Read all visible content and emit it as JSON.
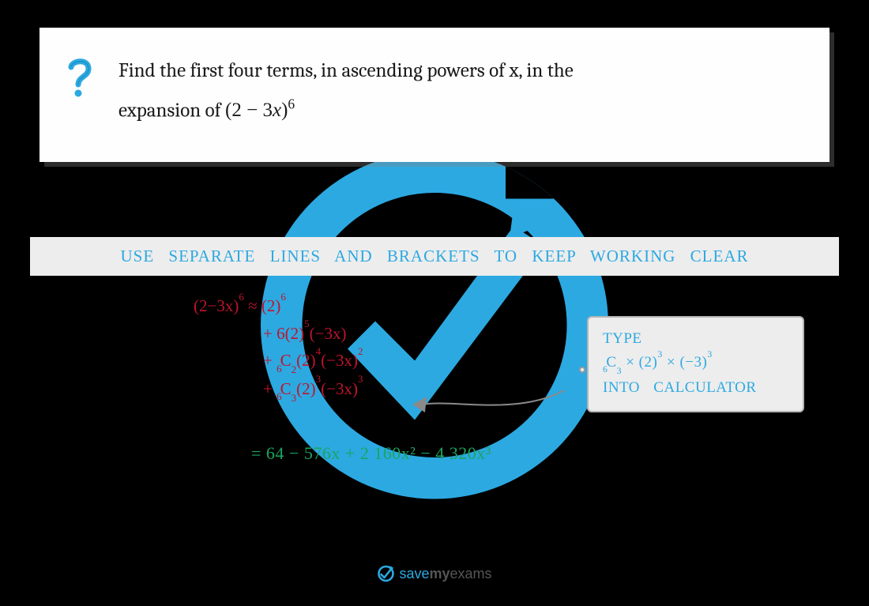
{
  "question": {
    "lead": "Find the first four terms, in ascending powers of x, in the",
    "line2_prefix": "expansion of ",
    "expression_base": "(2 − 3",
    "expression_var": "x",
    "expression_close": ")",
    "expression_exp": "6"
  },
  "tip": "USE SEPARATE LINES AND BRACKETS TO KEEP WORKING CLEAR",
  "work": {
    "lhs": "(2−3x)",
    "lhs_exp": "6",
    "approx": " ≈ (2)",
    "t0_exp": "6",
    "t1_pre": "+ 6(2)",
    "t1_e1": "5",
    "t1_mid": "(−3x)",
    "t2_pre": "+ ",
    "t2_cpre": "6",
    "t2_csym": "C",
    "t2_cpost": "2",
    "t2_a": "(2)",
    "t2_ae": "4",
    "t2_b": "(−3x)",
    "t2_be": "2",
    "t3_pre": "+ ",
    "t3_cpre": "6",
    "t3_csym": "C",
    "t3_cpost": "3",
    "t3_a": "(2)",
    "t3_ae": "3",
    "t3_b": "(−3x)",
    "t3_be": "3"
  },
  "callout": {
    "l1": "TYPE",
    "c_pre": "6",
    "c_sym": "C",
    "c_post": "3",
    "mid1": " × (2)",
    "e1": "3",
    "mid2": " × (−3)",
    "e2": "3",
    "l3a": "INTO",
    "l3b": "CALCULATOR"
  },
  "answer": "= 64 − 576x + 2 160x² − 4 320x³",
  "brand": {
    "a": "save",
    "b": "my",
    "c": "exams"
  },
  "colors": {
    "accent": "#2ca9e1",
    "work": "#c0142c",
    "answer": "#1ba560"
  }
}
